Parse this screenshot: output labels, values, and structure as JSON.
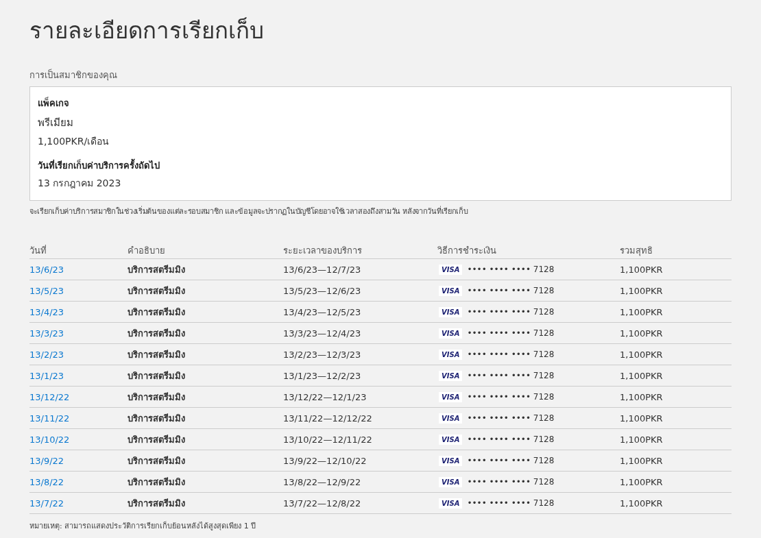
{
  "title": "รายละเอียดการเรียกเก็บ",
  "membership": {
    "heading": "การเป็นสมาชิกของคุณ",
    "package_label": "แพ็คเกจ",
    "plan": "พรีเมียม",
    "price": "1,100PKR/เดือน",
    "next_billing_label": "วันที่เรียกเก็บค่าบริการครั้งถัดไป",
    "next_billing_date": "13 กรกฎาคม 2023"
  },
  "membership_note": "จะเรียกเก็บค่าบริการสมาชิกในช่วงเริ่มต้นของแต่ละรอบสมาชิก และข้อมูลจะปรากฏในบัญชีโดยอาจใช้เวลาสองถึงสามวัน หลังจากวันที่เรียกเก็บ",
  "table": {
    "columns": [
      "วันที่",
      "คำอธิบาย",
      "ระยะเวลาของบริการ",
      "วิธีการชำระเงิน",
      "รวมสุทธิ"
    ],
    "rows": [
      {
        "date": "13/6/23",
        "description": "บริการสตรีมมิง",
        "period": "13/6/23—12/7/23",
        "card_brand": "VISA",
        "card": "•••• •••• •••• 7128",
        "total": "1,100PKR"
      },
      {
        "date": "13/5/23",
        "description": "บริการสตรีมมิง",
        "period": "13/5/23—12/6/23",
        "card_brand": "VISA",
        "card": "•••• •••• •••• 7128",
        "total": "1,100PKR"
      },
      {
        "date": "13/4/23",
        "description": "บริการสตรีมมิง",
        "period": "13/4/23—12/5/23",
        "card_brand": "VISA",
        "card": "•••• •••• •••• 7128",
        "total": "1,100PKR"
      },
      {
        "date": "13/3/23",
        "description": "บริการสตรีมมิง",
        "period": "13/3/23—12/4/23",
        "card_brand": "VISA",
        "card": "•••• •••• •••• 7128",
        "total": "1,100PKR"
      },
      {
        "date": "13/2/23",
        "description": "บริการสตรีมมิง",
        "period": "13/2/23—12/3/23",
        "card_brand": "VISA",
        "card": "•••• •••• •••• 7128",
        "total": "1,100PKR"
      },
      {
        "date": "13/1/23",
        "description": "บริการสตรีมมิง",
        "period": "13/1/23—12/2/23",
        "card_brand": "VISA",
        "card": "•••• •••• •••• 7128",
        "total": "1,100PKR"
      },
      {
        "date": "13/12/22",
        "description": "บริการสตรีมมิง",
        "period": "13/12/22—12/1/23",
        "card_brand": "VISA",
        "card": "•••• •••• •••• 7128",
        "total": "1,100PKR"
      },
      {
        "date": "13/11/22",
        "description": "บริการสตรีมมิง",
        "period": "13/11/22—12/12/22",
        "card_brand": "VISA",
        "card": "•••• •••• •••• 7128",
        "total": "1,100PKR"
      },
      {
        "date": "13/10/22",
        "description": "บริการสตรีมมิง",
        "period": "13/10/22—12/11/22",
        "card_brand": "VISA",
        "card": "•••• •••• •••• 7128",
        "total": "1,100PKR"
      },
      {
        "date": "13/9/22",
        "description": "บริการสตรีมมิง",
        "period": "13/9/22—12/10/22",
        "card_brand": "VISA",
        "card": "•••• •••• •••• 7128",
        "total": "1,100PKR"
      },
      {
        "date": "13/8/22",
        "description": "บริการสตรีมมิง",
        "period": "13/8/22—12/9/22",
        "card_brand": "VISA",
        "card": "•••• •••• •••• 7128",
        "total": "1,100PKR"
      },
      {
        "date": "13/7/22",
        "description": "บริการสตรีมมิง",
        "period": "13/7/22—12/8/22",
        "card_brand": "VISA",
        "card": "•••• •••• •••• 7128",
        "total": "1,100PKR"
      }
    ]
  },
  "footnote": "หมายเหตุ: สามารถแสดงประวัติการเรียกเก็บย้อนหลังได้สูงสุดเพียง 1 ปี"
}
